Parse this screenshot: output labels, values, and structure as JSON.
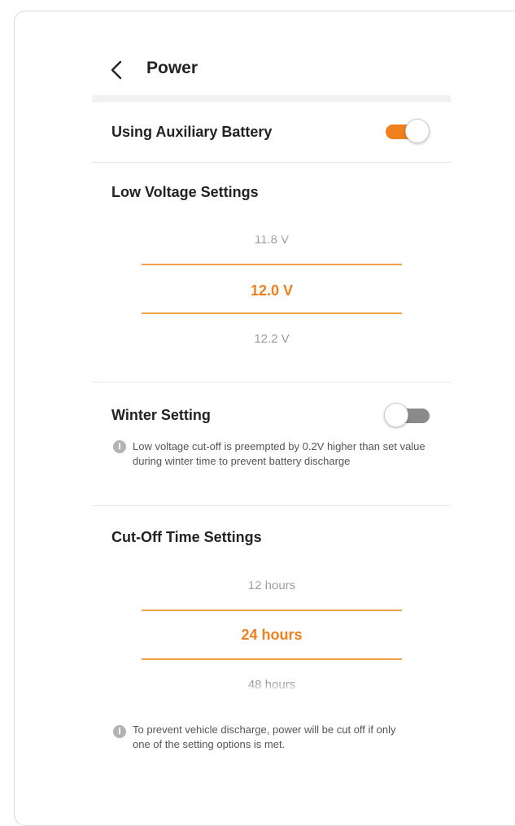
{
  "header": {
    "title": "Power",
    "back_icon": "chevron-left-icon"
  },
  "auxiliary_battery": {
    "label": "Using Auxiliary Battery",
    "enabled": true,
    "toggle_color": "#f07f1e"
  },
  "low_voltage": {
    "label": "Low Voltage Settings",
    "options": [
      "11.8 V",
      "12.0 V",
      "12.2 V"
    ],
    "selected": "12.0 V",
    "accent": "#f07f1e"
  },
  "winter": {
    "label": "Winter Setting",
    "enabled": false,
    "info_icon": "info-icon",
    "note": "Low voltage cut-off is preempted by 0.2V higher than set value during winter time to prevent battery discharge"
  },
  "cutoff_time": {
    "label": "Cut-Off Time Settings",
    "options": [
      "12 hours",
      "24 hours",
      "48 hours"
    ],
    "selected": "24 hours"
  },
  "footer": {
    "info_icon": "info-icon",
    "note": "To prevent vehicle discharge, power will be cut off if only one of the setting options is met."
  }
}
